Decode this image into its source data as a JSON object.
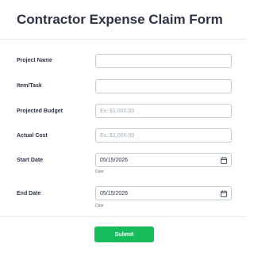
{
  "form": {
    "title": "Contractor Expense Claim Form",
    "fields": [
      {
        "label": "Project Name",
        "value": "",
        "placeholder": ""
      },
      {
        "label": "Item/Task",
        "value": "",
        "placeholder": ""
      },
      {
        "label": "Projected Budget",
        "value": "",
        "placeholder": "Ex: $1,000.00"
      },
      {
        "label": "Actual Cost",
        "value": "",
        "placeholder": "Ex: $1,000.00"
      }
    ],
    "start_date": {
      "label": "Start Date",
      "value": "05/15/2026",
      "sublabel": "Date",
      "icon": "calendar-icon"
    },
    "end_date": {
      "label": "End Date",
      "value": "05/15/2026",
      "sublabel": "Date",
      "icon": "calendar-icon"
    },
    "submit_label": "Submit"
  },
  "colors": {
    "submit": "#18bd5b",
    "title": "#2c3345",
    "border": "#c5cad4"
  }
}
